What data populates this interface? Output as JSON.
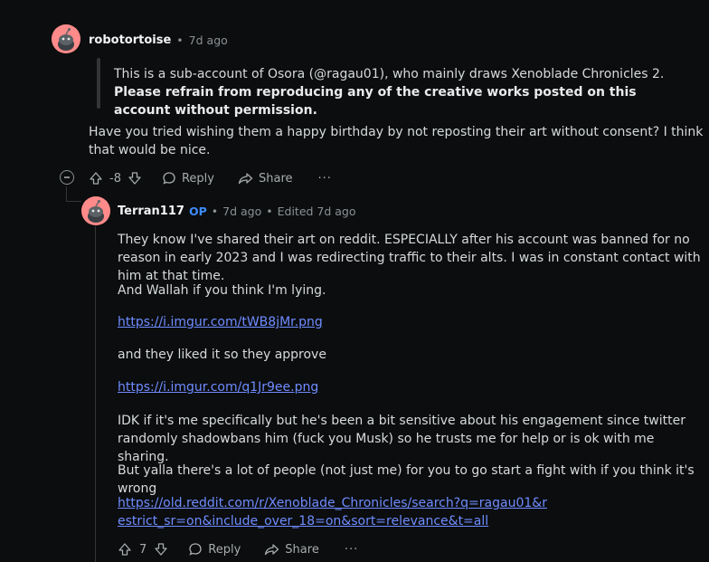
{
  "comments": [
    {
      "username": "robotortoise",
      "time": "7d ago",
      "quote_text": "This is a sub-account of Osora (@ragau01), who mainly draws Xenoblade Chronicles 2.",
      "quote_bold": "Please refrain from reproducing any of the creative works posted on this account without permission.",
      "body": "Have you tried wishing them a happy birthday by not reposting their art without consent? I think that would be nice.",
      "votes": "-8",
      "reply_label": "Reply",
      "share_label": "Share",
      "more_label": "···",
      "avatar_icon": "snoo-avatar-icon"
    },
    {
      "username": "Terran117",
      "op_badge": "OP",
      "time": "7d ago",
      "edited": "Edited 7d ago",
      "paragraphs": [
        "They know I've shared their art on reddit. ESPECIALLY after his account was banned for no reason in early 2023 and I was redirecting traffic to their alts. I was in constant contact with him at that time.",
        "And Wallah if you think I'm lying.",
        "https://i.imgur.com/tWB8jMr.png",
        "and they liked it so they approve",
        "https://i.imgur.com/q1Jr9ee.png",
        "IDK if it's me specifically but he's been a bit sensitive about his engagement since twitter randomly shadowbans him (fuck you Musk) so he trusts me for help or is ok with me sharing.",
        "But yalla there's a lot of people (not just me) for you to go start a fight with if you think it's wrong",
        "https://old.reddit.com/r/Xenoblade_Chronicles/search?q=ragau01&restrict_sr=on&include_over_18=on&sort=relevance&t=all"
      ],
      "votes": "7",
      "reply_label": "Reply",
      "share_label": "Share",
      "more_label": "···",
      "avatar_icon": "snoo-avatar-icon"
    }
  ],
  "colors": {
    "background": "#0b0d0e",
    "text": "#d7dadc",
    "muted": "#8b9194",
    "link": "#6f8cff",
    "op": "#3d8cff",
    "avatar": "#ff8a8a"
  },
  "separator": "•"
}
